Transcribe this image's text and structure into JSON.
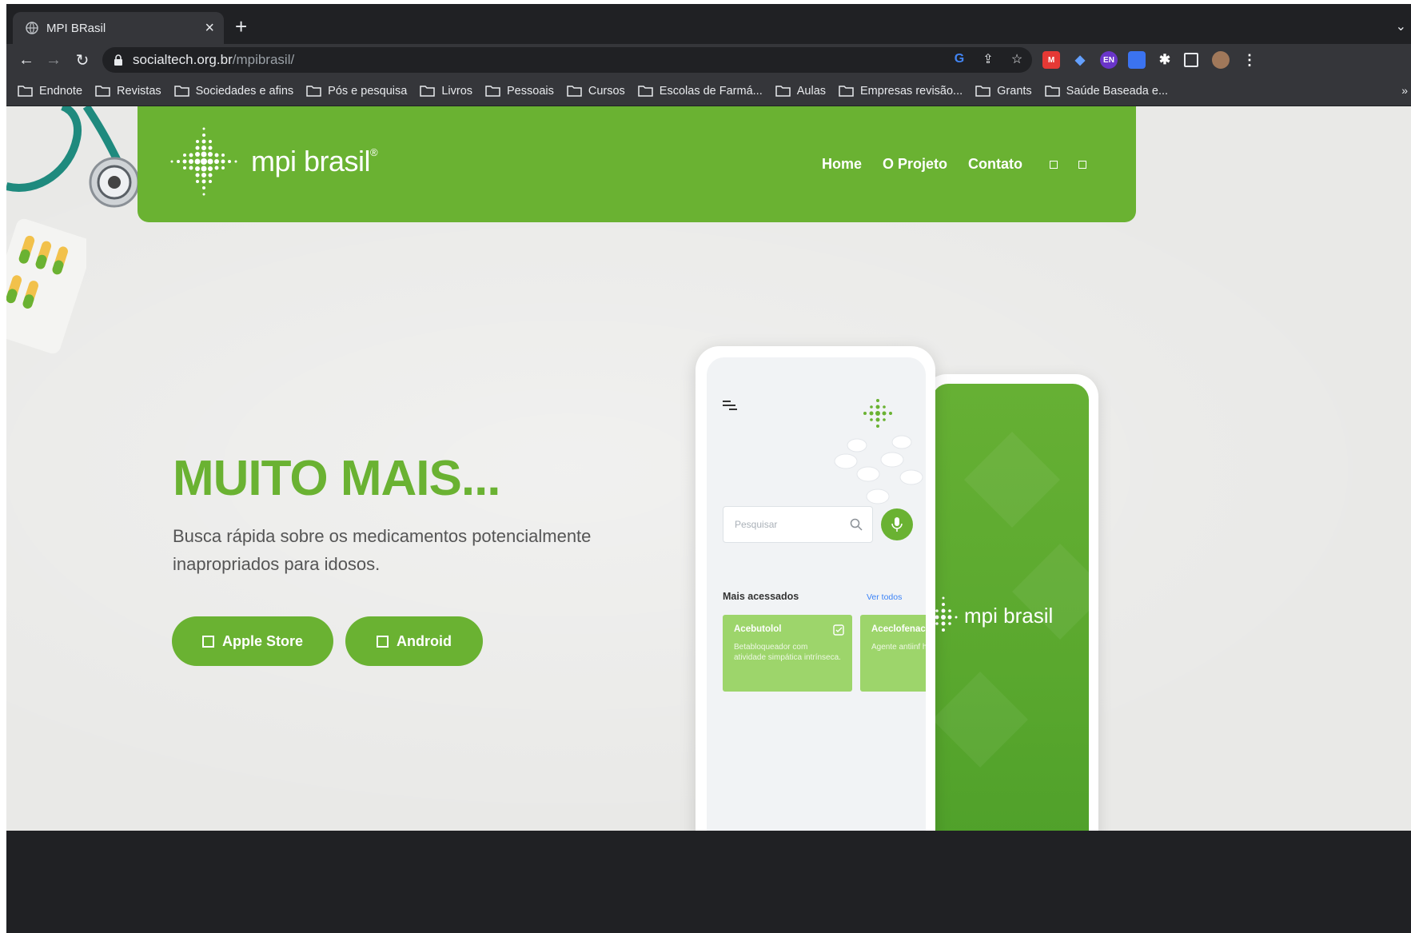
{
  "browser": {
    "tab_title": "MPI BRasil",
    "url_host": "socialtech.org.br",
    "url_path": "/mpibrasil/",
    "bookmarks": [
      "Endnote",
      "Revistas",
      "Sociedades e afins",
      "Pós e pesquisa",
      "Livros",
      "Pessoais",
      "Cursos",
      "Escolas de Farmá...",
      "Aulas",
      "Empresas revisão...",
      "Grants",
      "Saúde Baseada e..."
    ],
    "bookmarks_more": "»"
  },
  "site": {
    "logo_text": "mpi brasil",
    "logo_reg": "®",
    "nav": [
      "Home",
      "O Projeto",
      "Contato"
    ],
    "accent": "#6ab232"
  },
  "hero": {
    "title": "MUITO MAIS...",
    "subtitle": "Busca rápida sobre os medicamentos potencialmente inapropriados para idosos.",
    "buttons": [
      "Apple Store",
      "Android"
    ]
  },
  "phone": {
    "search_placeholder": "Pesquisar",
    "section_title": "Mais acessados",
    "see_all": "Ver todos",
    "cards": [
      {
        "title": "Acebutolol",
        "desc": "Betabloqueador com atividade simpática intrínseca."
      },
      {
        "title": "Aceclofenac",
        "desc": "Agente antiinf hormonal(AIN"
      }
    ],
    "back_logo": "mpi brasil"
  }
}
